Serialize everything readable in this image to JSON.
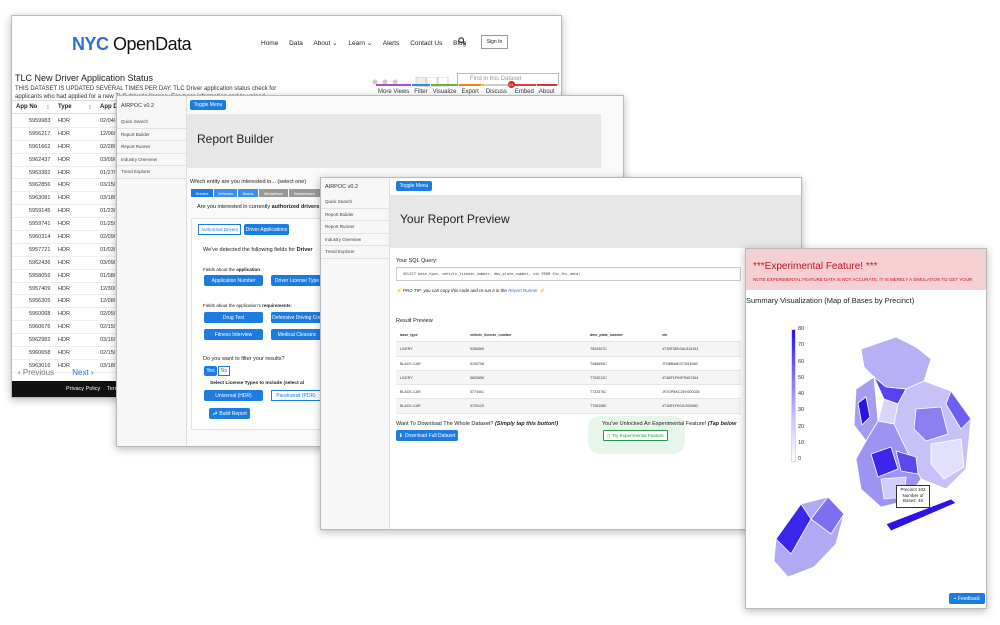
{
  "nyc": {
    "logo_nyc": "NYC",
    "logo_opendata": "OpenData",
    "nav": [
      "Home",
      "Data",
      "About ⌄",
      "Learn ⌄",
      "Alerts",
      "Contact Us",
      "Blog"
    ],
    "sign_in": "Sign In",
    "dataset_title": "TLC New Driver Application Status",
    "dataset_desc": "THIS DATASET IS UPDATED SEVERAL TIMES PER DAY. TLC Driver application status check for applicants who had applied for a new TLC driver's license. For more information and to upload",
    "find_placeholder": "Find in this Dataset",
    "tabs": [
      "More Views",
      "Filter",
      "Visualize",
      "Export",
      "Discuss",
      "Embed",
      "About"
    ],
    "tab_colors": [
      "#b04fc4",
      "#2f8bd6",
      "#6cb535",
      "#e38a1c",
      "#e3c31c",
      "#d84040",
      "#c43a3a"
    ],
    "discuss_badge": "21",
    "columns": [
      "App No",
      "Type",
      "App D"
    ],
    "rows": [
      [
        "5959983",
        "HDR",
        "02/04/"
      ],
      [
        "5956217",
        "HDR",
        "12/06/"
      ],
      [
        "5961662",
        "HDR",
        "02/28/"
      ],
      [
        "5962437",
        "HDR",
        "03/09/"
      ],
      [
        "5963382",
        "HDR",
        "01/27/"
      ],
      [
        "5962856",
        "HDR",
        "03/15/"
      ],
      [
        "5963081",
        "HDR",
        "03/18/"
      ],
      [
        "5959145",
        "HDR",
        "01/23/"
      ],
      [
        "5959741",
        "HDR",
        "01/25/"
      ],
      [
        "5960314",
        "HDR",
        "02/09/"
      ],
      [
        "5957721",
        "HDR",
        "01/03/"
      ],
      [
        "5962436",
        "HDR",
        "03/09/"
      ],
      [
        "5958056",
        "HDR",
        "01/08/"
      ],
      [
        "5957409",
        "HDR",
        "12/30/"
      ],
      [
        "5956305",
        "HDR",
        "12/08/"
      ],
      [
        "5960068",
        "HDR",
        "02/05/"
      ],
      [
        "5960676",
        "HDR",
        "02/15/"
      ],
      [
        "5962982",
        "HDR",
        "03/16/"
      ],
      [
        "5960658",
        "HDR",
        "02/15/"
      ],
      [
        "5963016",
        "HDR",
        "03/18/"
      ]
    ],
    "prev": "‹ Previous",
    "next": "Next ›",
    "footer": [
      "Privacy Policy",
      "Term"
    ]
  },
  "builder": {
    "brand": "AIRPOC v0.2",
    "toggle": "Toggle Menu",
    "sidebar": [
      "Quick Search",
      "Report Builder",
      "Report Runner",
      "Industry Overview",
      "Trend Explorer"
    ],
    "title": "Report Builder",
    "question1": "Which entity are you interested in... (select one)",
    "entities": [
      "Drivers",
      "Vehicles",
      "Bases",
      "Medallions",
      "Businesses"
    ],
    "question2_pre": "Are you interested in currently ",
    "question2_bold": "authorized drivers",
    "subtabs": [
      "Authorized Drivers",
      "Driver Applications"
    ],
    "detected_pre": "We've detected the following fields for ",
    "detected_bold": "Driver",
    "fields_app_pre": "Fields about the ",
    "fields_app_bold": "application",
    "app_fields": [
      "Application Number",
      "Driver License Type"
    ],
    "fields_req_pre": "Fields about the application's ",
    "fields_req_bold": "requirements",
    "req_fields": [
      "Drug Test",
      "Defensive Driving Cou",
      "Fitness Interview",
      "Medical Clearanc"
    ],
    "filter_q": "Do you want to filter your results?",
    "yes": "Yes",
    "no": "No",
    "license_label": "Select License Types to Include (select al",
    "license_types": [
      "Universal (HDR)",
      "Paratransit (PDR)"
    ],
    "build": "Build Report"
  },
  "preview": {
    "brand": "AIRPOC v0.2",
    "toggle": "Toggle Menu",
    "sidebar": [
      "Quick Search",
      "Report Builder",
      "Report Runner",
      "Industry Overview",
      "Trend Explorer"
    ],
    "title": "Your Report Preview",
    "sql_label": "Your SQL Query:",
    "sql": "SELECT base_type, vehicle_license_number, dmv_plate_number, vin FROM fhv_fhv_data;",
    "tip_pre": "PRO TIP: you can copy this code and re-run it in the ",
    "tip_link": "Report Runner",
    "result_label": "Result Preview",
    "columns": [
      "base_type",
      "vehicle_license_number",
      "dmv_plate_number",
      "vin"
    ],
    "rows": [
      [
        "LIVERY",
        "5286569",
        "T503307C",
        "4T1BF3EK0AU119193"
      ],
      [
        "BLACK-CAR",
        "5195798",
        "T486694C",
        "JTNBB46K373016380"
      ],
      [
        "LIVERY",
        "5653656",
        "T709012C",
        "4T4BF1FK0FR457364"
      ],
      [
        "BLACK-CAR",
        "5774461",
        "T723376C",
        "JF2GPBKC2EH300326"
      ],
      [
        "BLACK-CAR",
        "5729129",
        "T706198C",
        "4T1BF1FK0JU300983"
      ]
    ],
    "download_q_pre": "Want To Download The Whole Dataset? ",
    "download_q_bold": "(Simply tap this button!)",
    "download_btn": "Download Full Dataset",
    "unlock_pre": "You've Unlocked An Experimental Feature! ",
    "unlock_bold": "(Tap below",
    "try_btn": "Try Experimental Feature"
  },
  "experimental": {
    "title": "***Experimental Feature! ***",
    "note": "NOTE EXPERIMENTAL FEATURE DATA IS NOT ACCURATE. IT IS MERELY A SIMULATION TO GET YOUR",
    "map_title": "Summary Visualization (Map of Bases by Precinct)",
    "scale_ticks": [
      "80",
      "70",
      "60",
      "50",
      "40",
      "30",
      "20",
      "10",
      "0"
    ],
    "tooltip": [
      "Precinct 102",
      "Number of",
      "Bases: 48"
    ],
    "feedback": "Feedback",
    "scale_colors": [
      "#2a12e8",
      "#ffffff"
    ]
  }
}
